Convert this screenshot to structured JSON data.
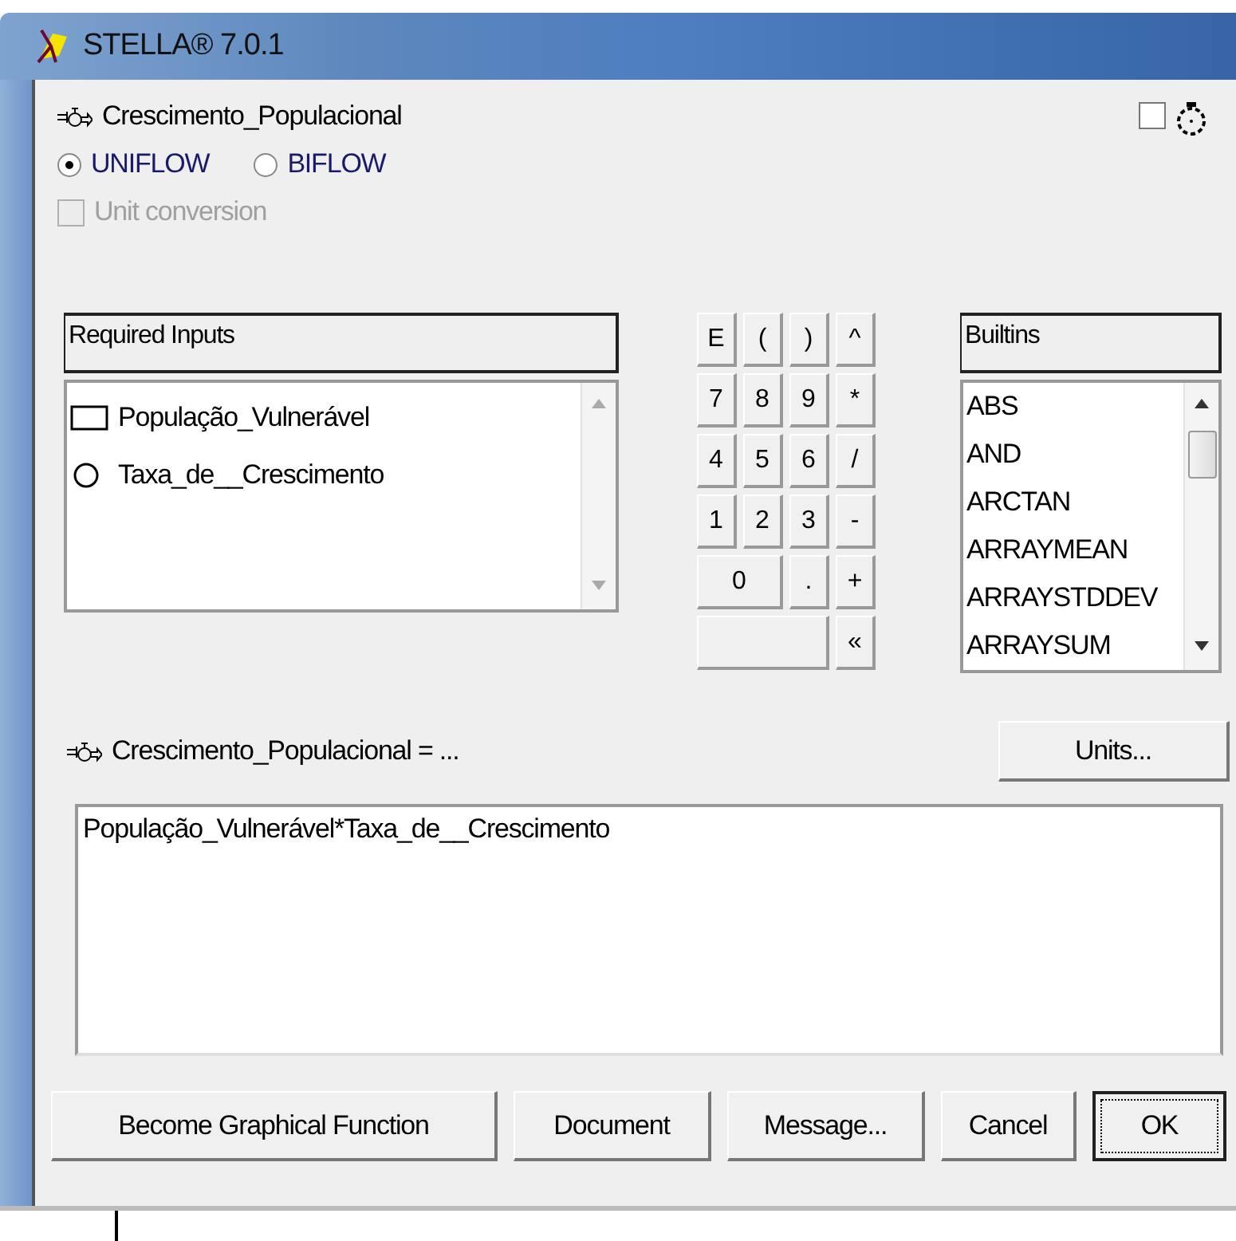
{
  "window": {
    "title": "STELLA® 7.0.1"
  },
  "flow": {
    "name": "Crescimento_Populacional"
  },
  "timer_toggle": {
    "checked": false
  },
  "flow_types": [
    {
      "label": "UNIFLOW",
      "selected": true
    },
    {
      "label": "BIFLOW",
      "selected": false
    }
  ],
  "unit_conversion": {
    "label": "Unit conversion",
    "checked": false,
    "disabled": true
  },
  "required_inputs": {
    "header": "Required Inputs",
    "items": [
      {
        "kind": "stock",
        "label": "População_Vulnerável"
      },
      {
        "kind": "converter",
        "label": "Taxa_de__Crescimento"
      }
    ]
  },
  "keypad": [
    [
      {
        "kind": "key",
        "label": "E"
      },
      {
        "kind": "key",
        "label": "("
      },
      {
        "kind": "key",
        "label": ")"
      },
      {
        "kind": "key",
        "label": "^"
      }
    ],
    [
      {
        "kind": "key",
        "label": "7"
      },
      {
        "kind": "key",
        "label": "8"
      },
      {
        "kind": "key",
        "label": "9"
      },
      {
        "kind": "key",
        "label": "*"
      }
    ],
    [
      {
        "kind": "key",
        "label": "4"
      },
      {
        "kind": "key",
        "label": "5"
      },
      {
        "kind": "key",
        "label": "6"
      },
      {
        "kind": "key",
        "label": "/"
      }
    ],
    [
      {
        "kind": "key",
        "label": "1"
      },
      {
        "kind": "key",
        "label": "2"
      },
      {
        "kind": "key",
        "label": "3"
      },
      {
        "kind": "key",
        "label": "-"
      }
    ],
    [
      {
        "kind": "double",
        "label": "0"
      },
      {
        "kind": "key",
        "label": "."
      },
      {
        "kind": "key",
        "label": "+"
      }
    ],
    [
      {
        "kind": "triple"
      },
      {
        "kind": "key",
        "label": "«"
      }
    ]
  ],
  "builtins": {
    "header": "Builtins",
    "items": [
      "ABS",
      "AND",
      "ARCTAN",
      "ARRAYMEAN",
      "ARRAYSTDDEV",
      "ARRAYSUM"
    ]
  },
  "equation": {
    "label": "Crescimento_Populacional = ...",
    "value": "População_Vulnerável*Taxa_de__Crescimento"
  },
  "units_button": "Units...",
  "buttons": [
    {
      "label": "Become Graphical Function",
      "focused": false
    },
    {
      "label": "Document",
      "focused": false
    },
    {
      "label": "Message...",
      "focused": false
    },
    {
      "label": "Cancel",
      "focused": false
    },
    {
      "label": "OK",
      "focused": true
    }
  ]
}
